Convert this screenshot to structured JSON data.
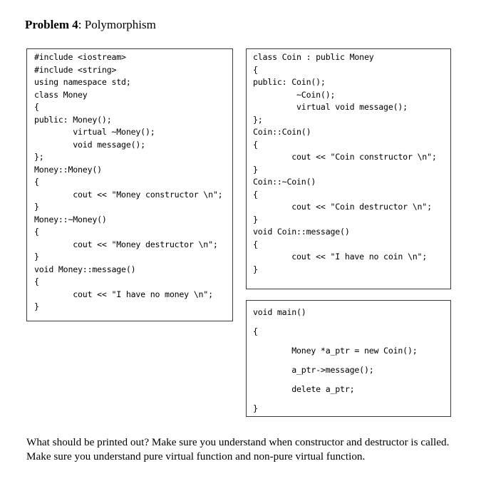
{
  "title": {
    "bold": "Problem 4",
    "rest": ": Polymorphism"
  },
  "code_left": [
    "#include <iostream>",
    "#include <string>",
    "using namespace std;",
    "class Money",
    "{",
    "public: Money();",
    "        virtual ~Money();",
    "        void message();",
    "};",
    "Money::Money()",
    "{",
    "        cout << \"Money constructor \\n\";",
    "}",
    "Money::~Money()",
    "{",
    "        cout << \"Money destructor \\n\";",
    "}",
    "void Money::message()",
    "{",
    "        cout << \"I have no money \\n\";",
    "}"
  ],
  "code_right_top": [
    "class Coin : public Money",
    "{",
    "public: Coin();",
    "         ~Coin();",
    "         virtual void message();",
    "};",
    "Coin::Coin()",
    "{",
    "        cout << \"Coin constructor \\n\";",
    "}",
    "Coin::~Coin()",
    "{",
    "        cout << \"Coin destructor \\n\";",
    "}",
    "void Coin::message()",
    "{",
    "        cout << \"I have no coin \\n\";",
    "}"
  ],
  "code_main": [
    "void main()",
    "{",
    "        Money *a_ptr = new Coin();",
    "        a_ptr->message();",
    "        delete a_ptr;",
    "}"
  ],
  "question": "What should be printed out? Make sure you understand when constructor and destructor is called. Make sure you understand pure virtual function and non-pure virtual function."
}
